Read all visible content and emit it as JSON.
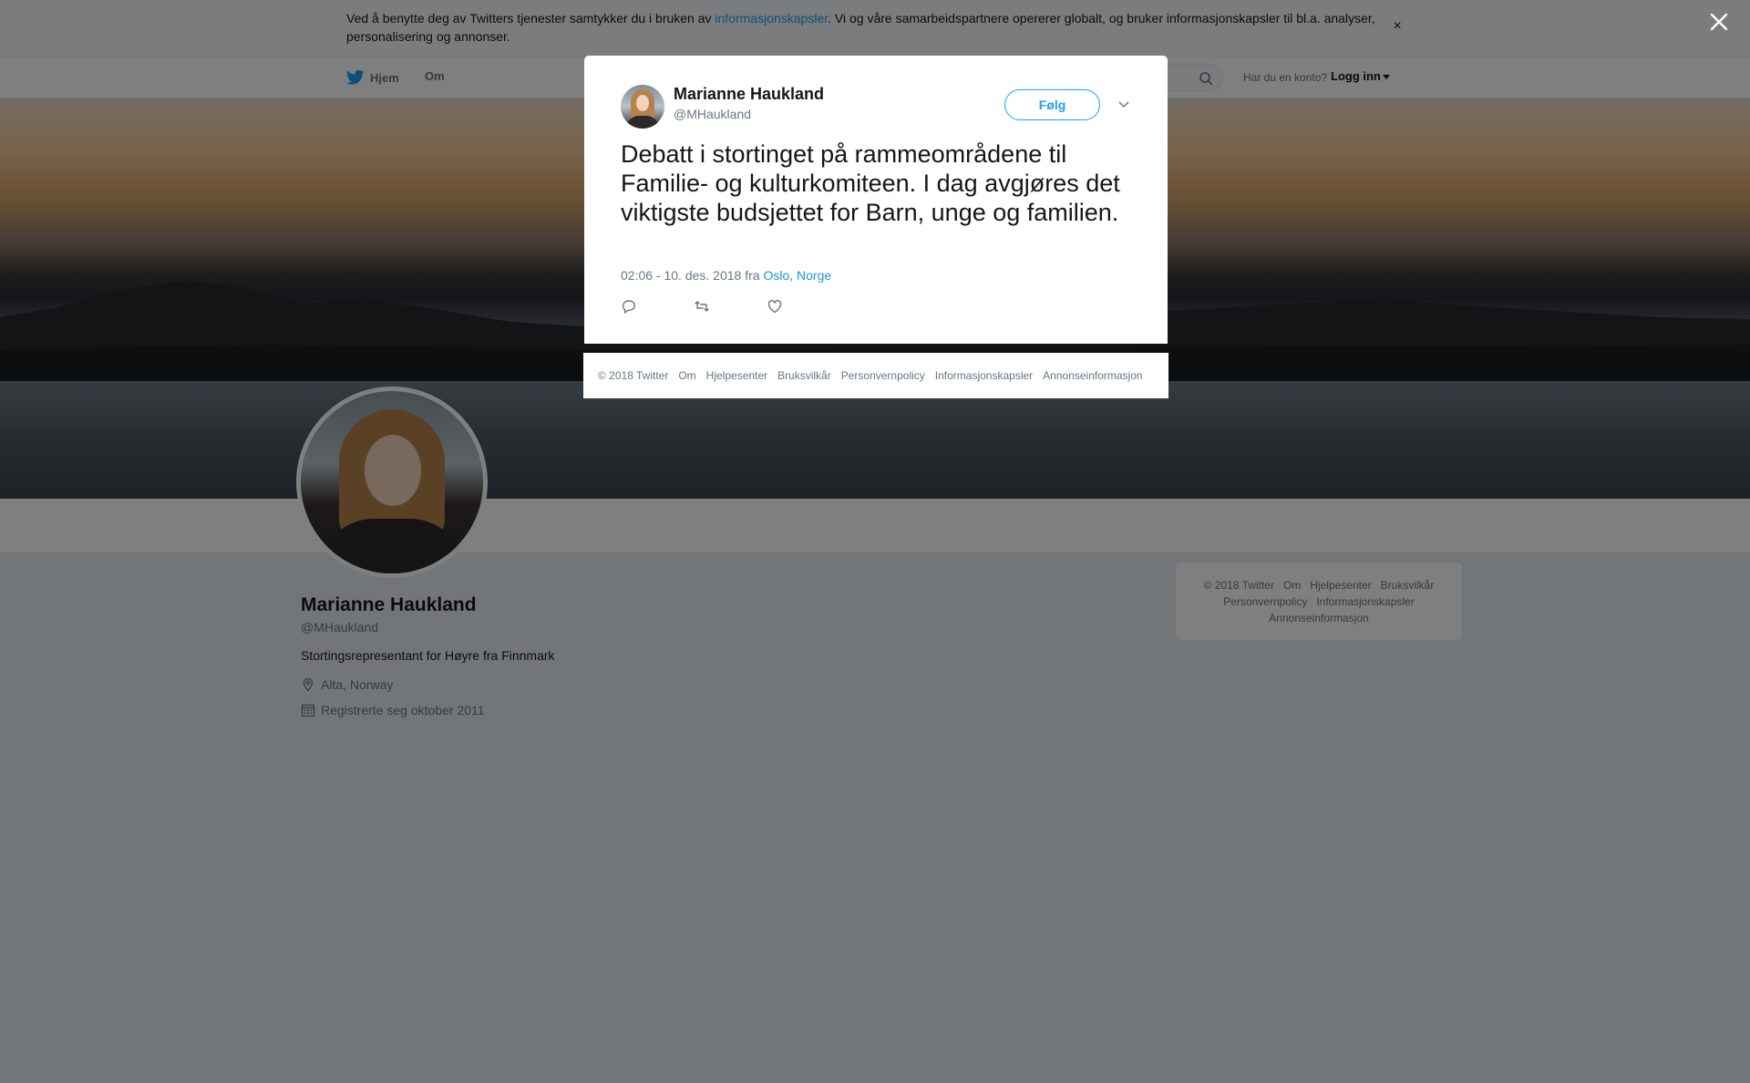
{
  "cookie_bar": {
    "text_before": "Ved å benytte deg av Twitters tjenester samtykker du i bruken av ",
    "link": "informasjonskapsler",
    "text_after": ". Vi og våre samarbeidspartnere opererer globalt, og bruker informasjonskapsler til bl.a. analyser, personalisering og annonser.",
    "close": "×"
  },
  "nav": {
    "home": "Hjem",
    "about": "Om",
    "login_question": "Har du en konto?",
    "login": "Logg inn"
  },
  "profile": {
    "name": "Marianne Haukland",
    "handle": "@MHaukland",
    "bio": "Stortingsrepresentant for Høyre fra Finnmark",
    "location": "Alta, Norway",
    "joined": "Registrerte seg oktober 2011"
  },
  "side_footer": {
    "links": [
      "© 2018 Twitter",
      "Om",
      "Hjelpesenter",
      "Bruksvilkår",
      "Personvernpolicy",
      "Informasjonskapsler",
      "Annonseinformasjon"
    ]
  },
  "tweet": {
    "name": "Marianne Haukland",
    "handle": "@MHaukland",
    "follow": "Følg",
    "text": "Debatt i stortinget på rammeområdene til Familie- og kulturkomiteen. I dag avgjøres det viktigste budsjettet for Barn, unge og familien.",
    "time": "02:06 - 10. des. 2018 fra ",
    "place": "Oslo, Norge"
  },
  "modal_footer": {
    "links": [
      "© 2018 Twitter",
      "Om",
      "Hjelpesenter",
      "Bruksvilkår",
      "Personvernpolicy",
      "Informasjonskapsler",
      "Annonseinformasjon"
    ]
  },
  "colors": {
    "accent": "#1da1f2",
    "text": "#14171a",
    "muted": "#657786"
  }
}
